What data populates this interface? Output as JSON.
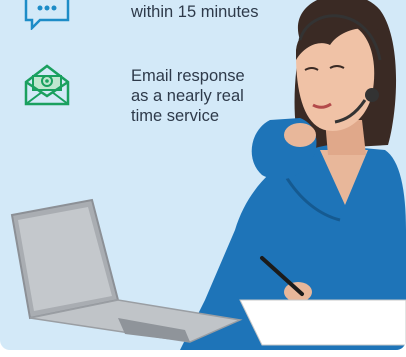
{
  "features": [
    {
      "icon": "chat-icon",
      "text": "within 15 minutes"
    },
    {
      "icon": "email-icon",
      "lines": [
        "Email response",
        "as a nearly real",
        "time service"
      ]
    }
  ],
  "colors": {
    "background": "#d3e9f8",
    "icon_green": "#1aa05f",
    "icon_blue": "#1d8cc7",
    "shirt": "#1e74b8",
    "text": "#2e3a4a"
  }
}
